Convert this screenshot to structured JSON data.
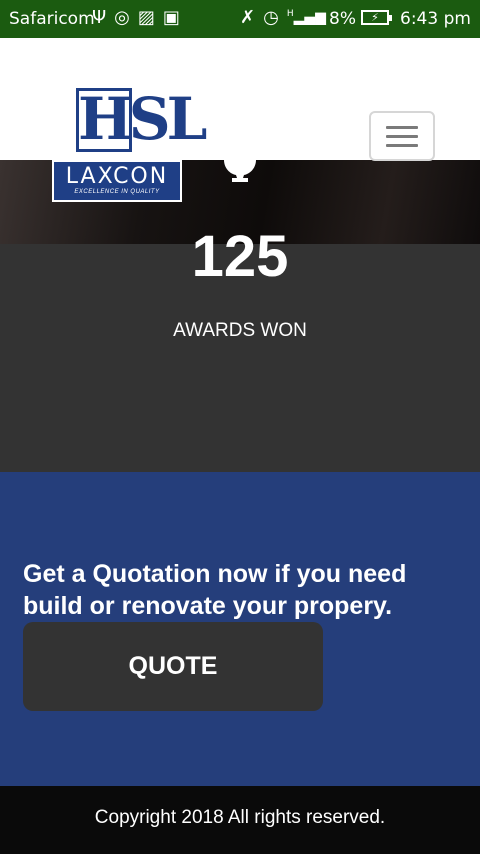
{
  "status_bar": {
    "carrier": "Safaricom",
    "battery_percent": "8%",
    "time": "6:43 pm",
    "network_type": "H",
    "icons": [
      "usb-icon",
      "whatsapp-icon",
      "image-icon",
      "message-icon",
      "mute-icon",
      "alarm-icon",
      "signal-icon",
      "battery-charging-icon"
    ]
  },
  "header": {
    "logo": {
      "top_text": "HSL",
      "bottom_text": "LAXCON",
      "tagline": "EXCELLENCE IN QUALITY"
    },
    "menu_icon": "hamburger-menu-icon"
  },
  "stats": {
    "icon": "trophy-icon",
    "value": "125",
    "label": "AWARDS WON"
  },
  "quote": {
    "text": "Get a Quotation now if you need build or renovate your propery.",
    "button_label": "QUOTE"
  },
  "footer": {
    "copyright": "Copyright 2018 All rights reserved."
  },
  "colors": {
    "status_bar": "#1b5b10",
    "brand_blue": "#253e7b",
    "dark_gray": "#333333",
    "footer": "#0a0a0a"
  }
}
